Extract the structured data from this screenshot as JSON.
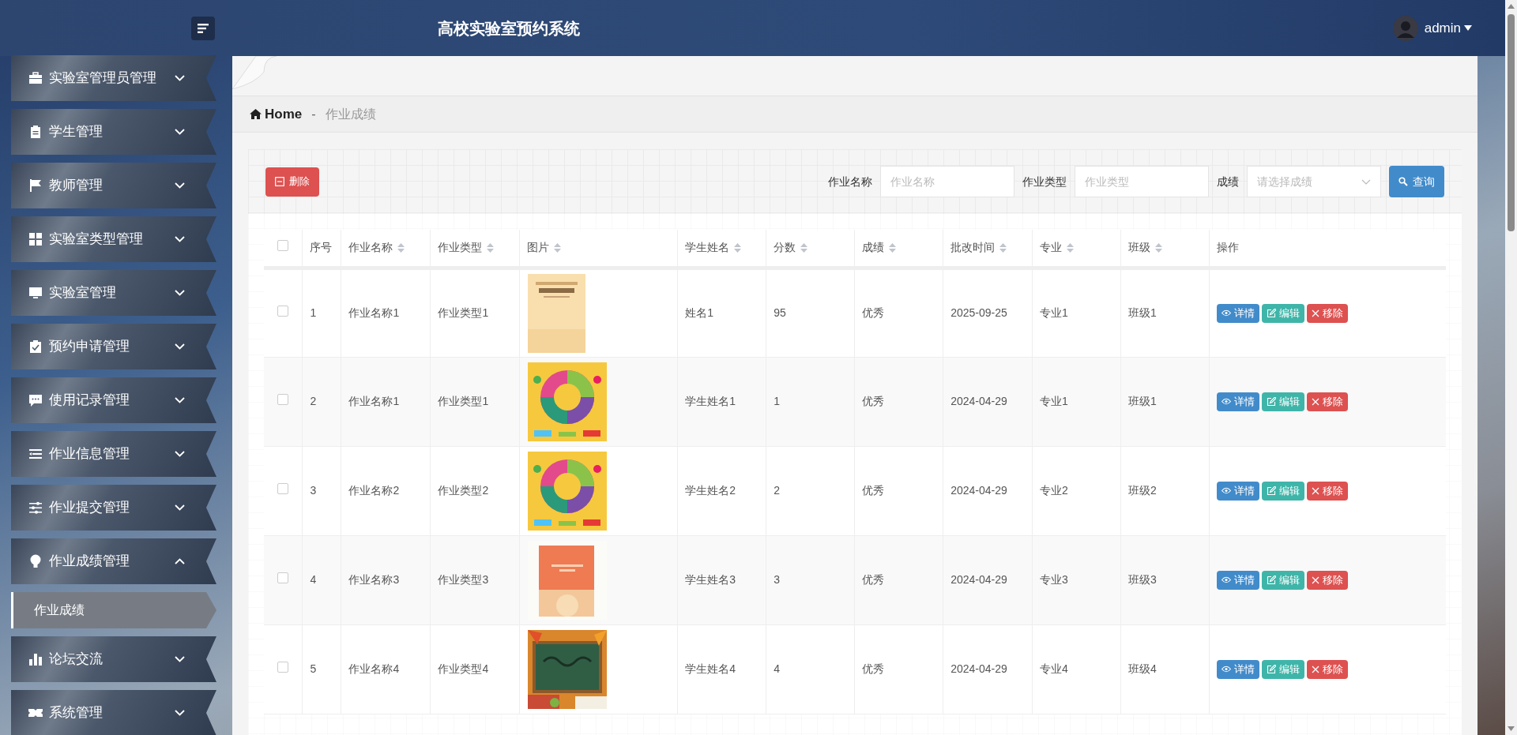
{
  "header": {
    "title": "高校实验室预约系统",
    "user": "admin"
  },
  "sidebar": {
    "items": [
      {
        "label": "实验室管理员管理",
        "expanded": false
      },
      {
        "label": "学生管理",
        "expanded": false
      },
      {
        "label": "教师管理",
        "expanded": false
      },
      {
        "label": "实验室类型管理",
        "expanded": false
      },
      {
        "label": "实验室管理",
        "expanded": false
      },
      {
        "label": "预约申请管理",
        "expanded": false
      },
      {
        "label": "使用记录管理",
        "expanded": false
      },
      {
        "label": "作业信息管理",
        "expanded": false
      },
      {
        "label": "作业提交管理",
        "expanded": false
      },
      {
        "label": "作业成绩管理",
        "expanded": true,
        "children": [
          {
            "label": "作业成绩",
            "selected": true
          }
        ]
      },
      {
        "label": "论坛交流",
        "expanded": false
      },
      {
        "label": "系统管理",
        "expanded": false
      }
    ]
  },
  "breadcrumb": {
    "home": "Home",
    "separator": "-",
    "current": "作业成绩"
  },
  "toolbar": {
    "delete_button": "删除",
    "filters": [
      {
        "kind": "input",
        "label": "作业名称",
        "placeholder": "作业名称"
      },
      {
        "kind": "input",
        "label": "作业类型",
        "placeholder": "作业类型"
      },
      {
        "kind": "select",
        "label": "成绩",
        "placeholder": "请选择成绩"
      }
    ],
    "search_button": "查询"
  },
  "table": {
    "select_all_checked": false,
    "columns": [
      {
        "label": "序号",
        "sortable": false
      },
      {
        "label": "作业名称",
        "sortable": true
      },
      {
        "label": "作业类型",
        "sortable": true
      },
      {
        "label": "图片",
        "sortable": true
      },
      {
        "label": "学生姓名",
        "sortable": true
      },
      {
        "label": "分数",
        "sortable": true
      },
      {
        "label": "成绩",
        "sortable": true
      },
      {
        "label": "批改时间",
        "sortable": true
      },
      {
        "label": "专业",
        "sortable": true
      },
      {
        "label": "班级",
        "sortable": true
      },
      {
        "label": "操作",
        "sortable": false
      }
    ],
    "rows": [
      {
        "checked": false,
        "cells": [
          "1",
          "作业名称1",
          "作业类型1",
          "",
          "姓名1",
          "95",
          "优秀",
          "2025-09-25",
          "专业1",
          "班级1"
        ],
        "actions": [
          "详情",
          "编辑",
          "移除"
        ]
      },
      {
        "checked": false,
        "cells": [
          "2",
          "作业名称1",
          "作业类型1",
          "",
          "学生姓名1",
          "1",
          "优秀",
          "2024-04-29",
          "专业1",
          "班级1"
        ],
        "actions": [
          "详情",
          "编辑",
          "移除"
        ]
      },
      {
        "checked": false,
        "cells": [
          "3",
          "作业名称2",
          "作业类型2",
          "",
          "学生姓名2",
          "2",
          "优秀",
          "2024-04-29",
          "专业2",
          "班级2"
        ],
        "actions": [
          "详情",
          "编辑",
          "移除"
        ]
      },
      {
        "checked": false,
        "cells": [
          "4",
          "作业名称3",
          "作业类型3",
          "",
          "学生姓名3",
          "3",
          "优秀",
          "2024-04-29",
          "专业3",
          "班级3"
        ],
        "actions": [
          "详情",
          "编辑",
          "移除"
        ]
      },
      {
        "checked": false,
        "cells": [
          "5",
          "作业名称4",
          "作业类型4",
          "",
          "学生姓名4",
          "4",
          "优秀",
          "2024-04-29",
          "专业4",
          "班级4"
        ],
        "actions": [
          "详情",
          "编辑",
          "移除"
        ]
      }
    ]
  }
}
